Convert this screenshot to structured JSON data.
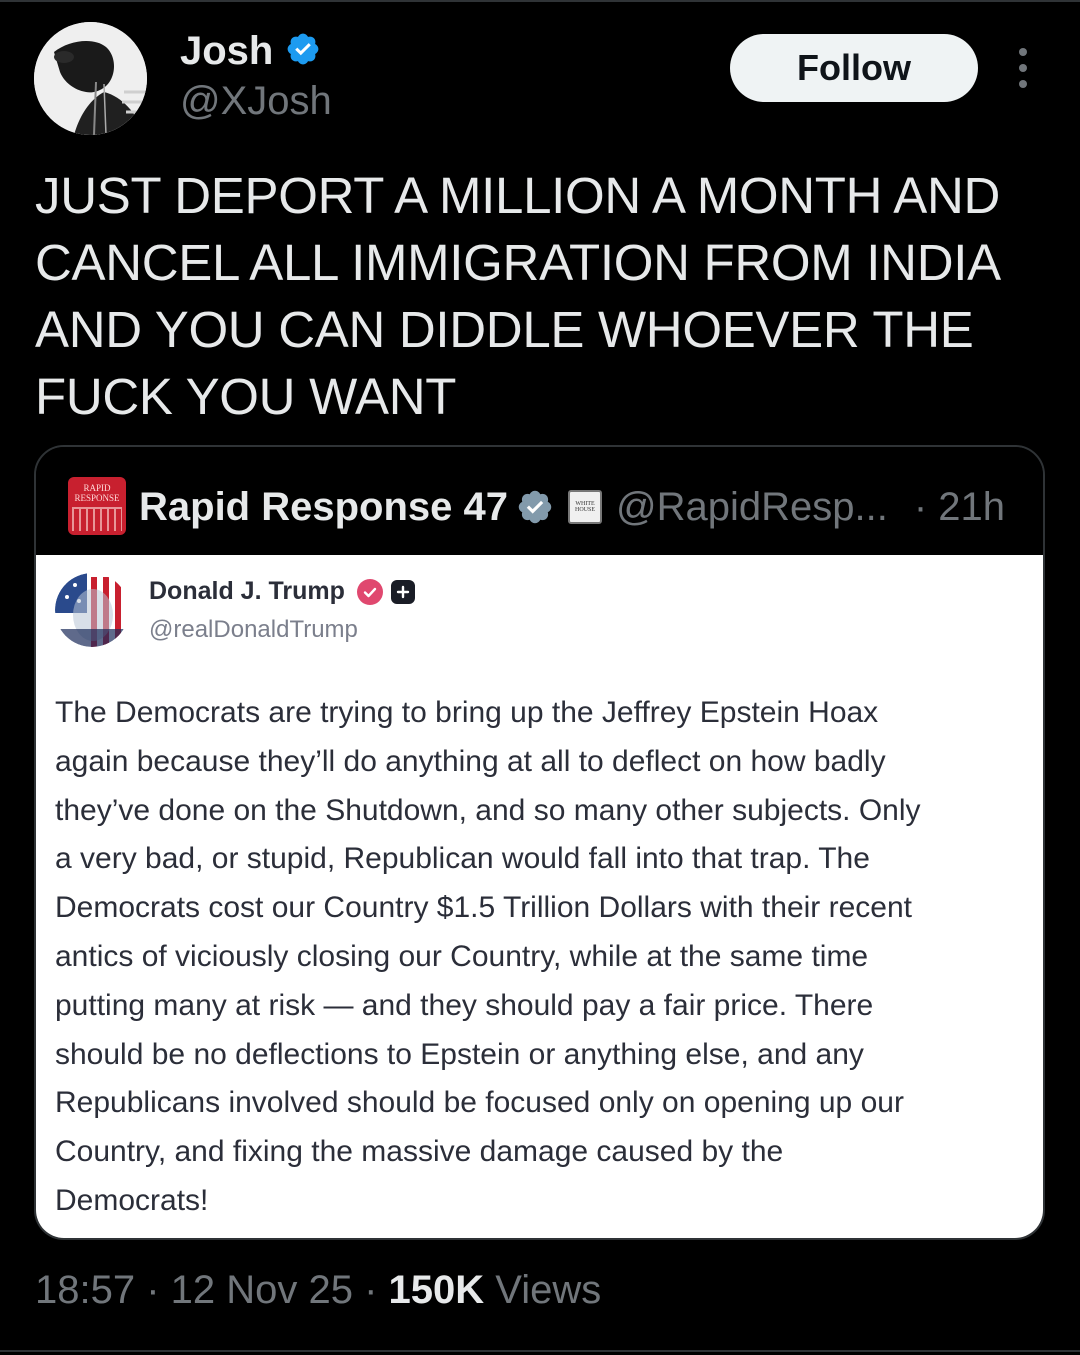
{
  "colors": {
    "background": "#000000",
    "text_primary": "#e7e9ea",
    "text_secondary": "#71767b",
    "verified_blue": "#1d9bf0",
    "follow_button_bg": "#eff3f4",
    "truth_verified": "#e0486f"
  },
  "post": {
    "author_name": "Josh",
    "author_handle": "@XJosh",
    "verified_icon": "verified-badge-icon",
    "follow_label": "Follow",
    "more_icon": "more-vertical-icon",
    "text": "JUST DEPORT A MILLION A MONTH AND\nCANCEL ALL IMMIGRATION FROM INDIA\nAND YOU CAN DIDDLE WHOEVER THE\nFUCK YOU WANT"
  },
  "quote": {
    "author_name": "Rapid Response 47",
    "author_handle": "@RapidResp...",
    "time": "· 21h",
    "avatar_text": "RAPID\nRESPONSE",
    "affiliation_badge_text": "WHITE\nHOUSE",
    "embedded": {
      "author_name": "Donald J. Trump",
      "author_handle": "@realDonaldTrump",
      "text": "The Democrats are trying to bring up the Jeffrey Epstein Hoax\nagain because they’ll do anything at all to deflect on how badly\nthey’ve done on the Shutdown, and so many other subjects. Only\na very bad, or stupid, Republican would fall into that trap. The\nDemocrats cost our Country $1.5 Trillion Dollars with their recent\nantics of viciously closing our Country, while at the same time\nputting many at risk — and they should pay a fair price. There\nshould be no deflections to Epstein or anything else, and any\nRepublicans involved should be focused only on opening up our\nCountry, and fixing the massive damage caused by the\nDemocrats!"
    }
  },
  "meta": {
    "time": "18:57",
    "separator": " · ",
    "date": "12 Nov 25",
    "views_count": "150K",
    "views_label": " Views"
  }
}
